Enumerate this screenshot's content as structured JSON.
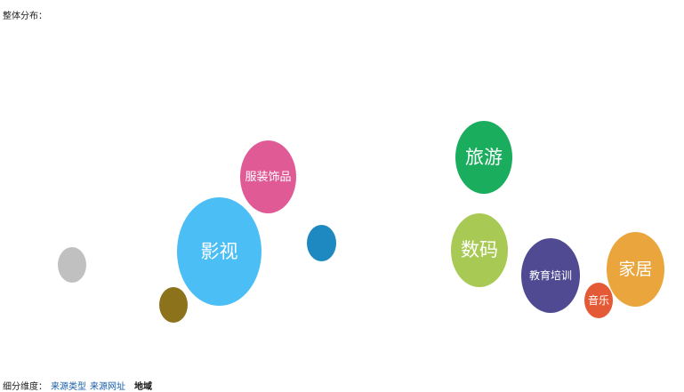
{
  "header": {
    "title": "整体分布："
  },
  "bubbles": [
    {
      "label": "",
      "color": "#c0c0c0"
    },
    {
      "label": "影视",
      "color": "#4bbef5"
    },
    {
      "label": "",
      "color": "#8c721b"
    },
    {
      "label": "服装饰品",
      "color": "#e05a96"
    },
    {
      "label": "",
      "color": "#1e88c0"
    },
    {
      "label": "旅游",
      "color": "#1aad5e"
    },
    {
      "label": "数码",
      "color": "#a9c955"
    },
    {
      "label": "教育培训",
      "color": "#4f4a91"
    },
    {
      "label": "音乐",
      "color": "#e55a36"
    },
    {
      "label": "家居",
      "color": "#eaa63c"
    }
  ],
  "footer": {
    "dimension_label": "细分维度：",
    "links": [
      "来源类型",
      "来源网址"
    ],
    "region": "地域"
  }
}
